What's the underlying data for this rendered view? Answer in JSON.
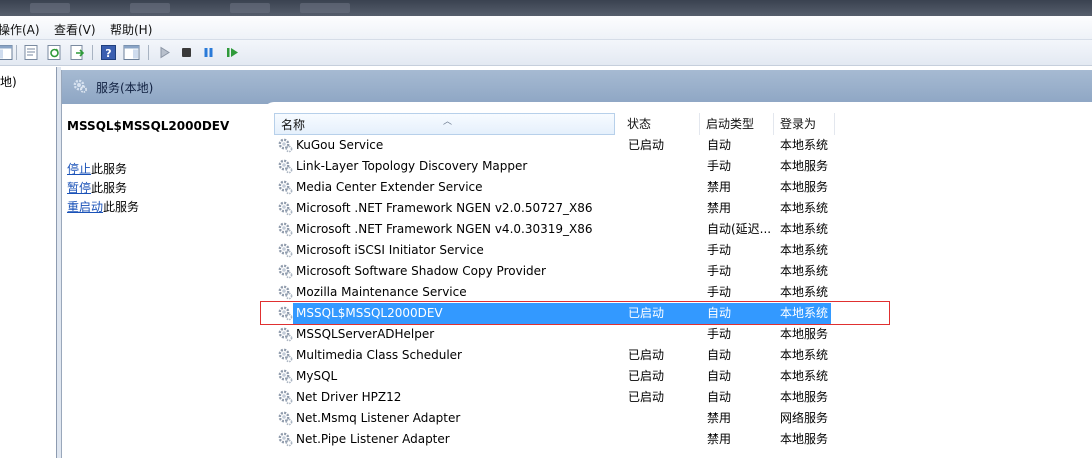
{
  "menubar": {
    "action": "操作(A)",
    "view": "查看(V)",
    "help": "帮助(H)"
  },
  "tree": {
    "item": "地)"
  },
  "pane": {
    "header_title": "服务(本地)"
  },
  "description": {
    "service_name": "MSSQL$MSSQL2000DEV",
    "stop_link": "停止",
    "stop_suffix": "此服务",
    "pause_link": "暂停",
    "pause_suffix": "此服务",
    "restart_link": "重启动",
    "restart_suffix": "此服务"
  },
  "columns": {
    "name": "名称",
    "status": "状态",
    "startup": "启动类型",
    "logon": "登录为"
  },
  "services": [
    {
      "name": "KuGou Service",
      "status": "已启动",
      "startup": "自动",
      "logon": "本地系统",
      "selected": false
    },
    {
      "name": "Link-Layer Topology Discovery Mapper",
      "status": "",
      "startup": "手动",
      "logon": "本地服务",
      "selected": false
    },
    {
      "name": "Media Center Extender Service",
      "status": "",
      "startup": "禁用",
      "logon": "本地服务",
      "selected": false
    },
    {
      "name": "Microsoft .NET Framework NGEN v2.0.50727_X86",
      "status": "",
      "startup": "禁用",
      "logon": "本地系统",
      "selected": false
    },
    {
      "name": "Microsoft .NET Framework NGEN v4.0.30319_X86",
      "status": "",
      "startup": "自动(延迟...",
      "logon": "本地系统",
      "selected": false
    },
    {
      "name": "Microsoft iSCSI Initiator Service",
      "status": "",
      "startup": "手动",
      "logon": "本地系统",
      "selected": false
    },
    {
      "name": "Microsoft Software Shadow Copy Provider",
      "status": "",
      "startup": "手动",
      "logon": "本地系统",
      "selected": false
    },
    {
      "name": "Mozilla Maintenance Service",
      "status": "",
      "startup": "手动",
      "logon": "本地系统",
      "selected": false
    },
    {
      "name": "MSSQL$MSSQL2000DEV",
      "status": "已启动",
      "startup": "自动",
      "logon": "本地系统",
      "selected": true
    },
    {
      "name": "MSSQLServerADHelper",
      "status": "",
      "startup": "手动",
      "logon": "本地服务",
      "selected": false
    },
    {
      "name": "Multimedia Class Scheduler",
      "status": "已启动",
      "startup": "自动",
      "logon": "本地系统",
      "selected": false
    },
    {
      "name": "MySQL",
      "status": "已启动",
      "startup": "自动",
      "logon": "本地系统",
      "selected": false
    },
    {
      "name": "Net Driver HPZ12",
      "status": "已启动",
      "startup": "自动",
      "logon": "本地服务",
      "selected": false
    },
    {
      "name": "Net.Msmq Listener Adapter",
      "status": "",
      "startup": "禁用",
      "logon": "网络服务",
      "selected": false
    },
    {
      "name": "Net.Pipe Listener Adapter",
      "status": "",
      "startup": "禁用",
      "logon": "本地服务",
      "selected": false
    }
  ],
  "icons": {
    "service": "service-gear-icon",
    "toolbar": [
      "console-tree-icon",
      "properties-icon",
      "refresh-icon",
      "export-list-icon",
      "help-icon",
      "show-hide-action-pane-icon",
      "start-service-icon",
      "stop-service-icon",
      "pause-service-icon",
      "resume-service-icon"
    ]
  },
  "colors": {
    "selection": "#3399ff",
    "link": "#1a52b8",
    "highlight_box": "#e03030",
    "pane_header": "#8ea6c4"
  }
}
